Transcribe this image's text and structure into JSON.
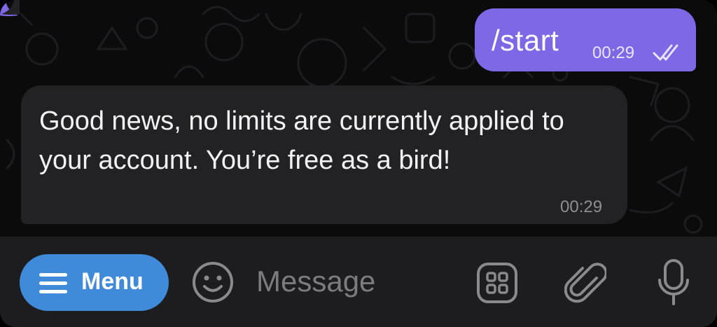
{
  "messages": [
    {
      "direction": "outgoing",
      "text": "/start",
      "time": "00:29",
      "status": "read"
    },
    {
      "direction": "incoming",
      "text": "Good news, no limits are currently applied to your account. You’re free as a bird!",
      "time": "00:29"
    }
  ],
  "input_bar": {
    "menu_label": "Menu",
    "message_placeholder": "Message",
    "icons": [
      "menu-icon",
      "emoji-icon",
      "bot-commands-icon",
      "attach-icon",
      "microphone-icon"
    ]
  },
  "colors": {
    "outgoing_bubble": "#7f68e6",
    "incoming_bubble": "#222224",
    "menu_button": "#3f8ad9",
    "input_bar": "#1d1d1f",
    "chat_background": "#0b0b0c"
  }
}
